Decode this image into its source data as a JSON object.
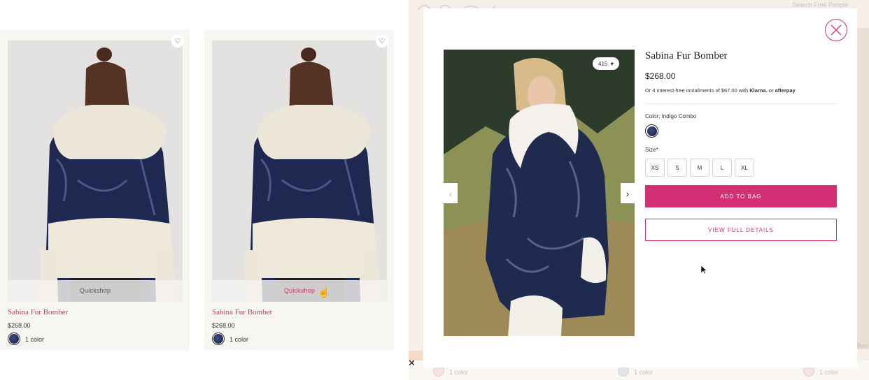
{
  "grid": {
    "cards": [
      {
        "name": "Sabina Fur Bomber",
        "price": "$268.00",
        "colors": "1 color",
        "quickshop": "Quickshop"
      },
      {
        "name": "Sabina Fur Bomber",
        "price": "$268.00",
        "colors": "1 color",
        "quickshop": "Quickshop"
      }
    ]
  },
  "backdrop": {
    "search_text": "Search Free People",
    "items": [
      {
        "colors": "1 color"
      },
      {
        "colors": "1 color"
      },
      {
        "colors": "1 color"
      }
    ],
    "partial_text": "Bou"
  },
  "modal": {
    "title": "Sabina Fur Bomber",
    "price": "$268.00",
    "installments_prefix": "Or 4 interest-free installments of $67.00 with",
    "klarna": "Klarna.",
    "installments_or": "or",
    "afterpay": "afterpay",
    "likes": "415",
    "color_label": "Color: Indigo Combo",
    "size_label": "Size*",
    "sizes": [
      "XS",
      "S",
      "M",
      "L",
      "XL"
    ],
    "add_to_bag": "ADD TO BAG",
    "view_details": "VIEW FULL DETAILS"
  },
  "colors": {
    "accent": "#d42e74",
    "swatch": "#1d2650",
    "backdrop": "#f5efe8"
  }
}
